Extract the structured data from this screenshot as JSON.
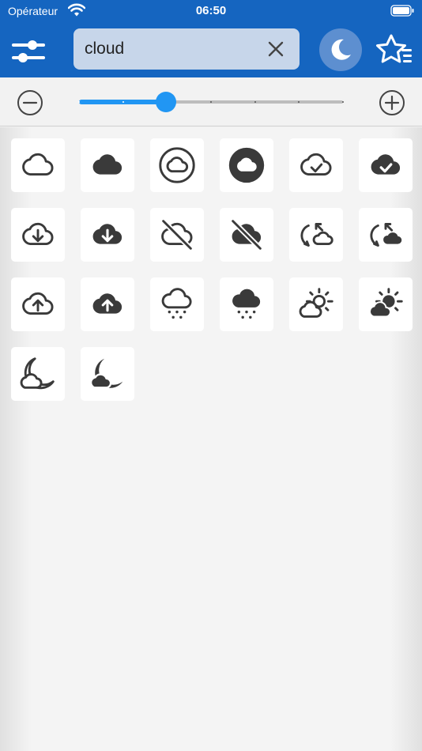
{
  "status_bar": {
    "carrier": "Opérateur",
    "time": "06:50"
  },
  "search": {
    "value": "cloud",
    "placeholder": ""
  },
  "zoom": {
    "level": 0.33,
    "steps": 7
  },
  "colors": {
    "header": "#1565c0",
    "accent": "#2196f3",
    "icon": "#3a3a3a"
  },
  "icons": [
    {
      "name": "cloud-icon"
    },
    {
      "name": "cloud-filled-icon"
    },
    {
      "name": "cloud-circle-icon"
    },
    {
      "name": "cloud-circle-filled-icon"
    },
    {
      "name": "cloud-done-icon"
    },
    {
      "name": "cloud-done-filled-icon"
    },
    {
      "name": "cloud-download-icon"
    },
    {
      "name": "cloud-download-filled-icon"
    },
    {
      "name": "cloud-off-icon"
    },
    {
      "name": "cloud-off-filled-icon"
    },
    {
      "name": "cloud-sync-icon"
    },
    {
      "name": "cloud-sync-filled-icon"
    },
    {
      "name": "cloud-upload-icon"
    },
    {
      "name": "cloud-upload-filled-icon"
    },
    {
      "name": "weather-snow-icon"
    },
    {
      "name": "weather-snow-filled-icon"
    },
    {
      "name": "weather-partly-cloudy-day-icon"
    },
    {
      "name": "weather-partly-cloudy-day-filled-icon"
    },
    {
      "name": "weather-partly-cloudy-night-icon"
    },
    {
      "name": "weather-partly-cloudy-night-filled-icon"
    }
  ]
}
